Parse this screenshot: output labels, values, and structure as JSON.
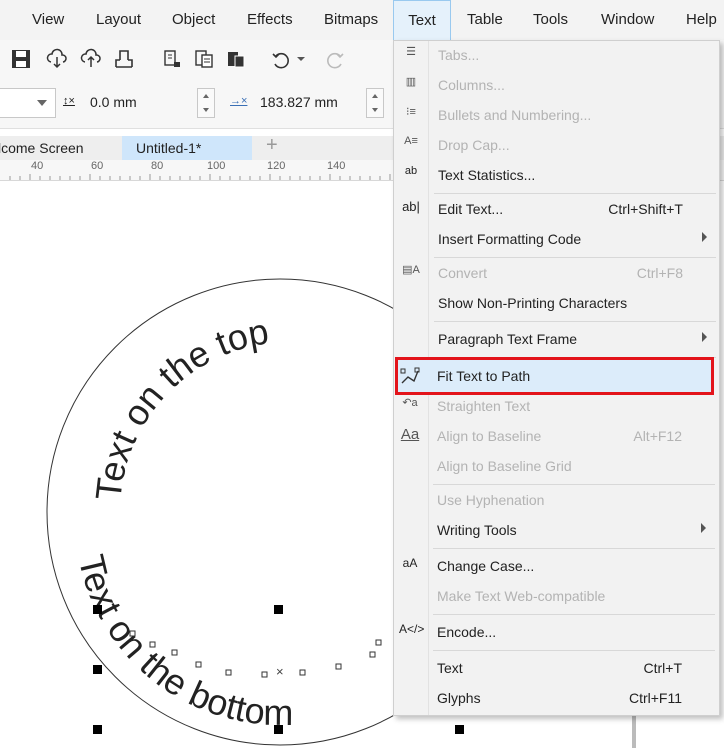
{
  "menubar": {
    "items": [
      "View",
      "Layout",
      "Object",
      "Effects",
      "Bitmaps",
      "Text",
      "Table",
      "Tools",
      "Window",
      "Help"
    ],
    "active": "Text"
  },
  "propbar": {
    "x_value": "0.0 mm",
    "width_value": "183.827 mm"
  },
  "tabs": {
    "welcome": "lcome Screen",
    "untitled": "Untitled-1*"
  },
  "ruler": {
    "labels": [
      "40",
      "60",
      "80",
      "100",
      "120",
      "140"
    ]
  },
  "canvas": {
    "top_text": "Text on the top",
    "bottom_text": "Text on the bottom"
  },
  "text_menu": {
    "items": [
      {
        "label": "Tabs...",
        "shortcut": "",
        "disabled": true,
        "submenu": false,
        "icon": "tabs-icon"
      },
      {
        "label": "Columns...",
        "shortcut": "",
        "disabled": true,
        "submenu": false,
        "icon": "columns-icon"
      },
      {
        "label": "Bullets and Numbering...",
        "shortcut": "",
        "disabled": true,
        "submenu": false,
        "icon": "bullets-icon"
      },
      {
        "label": "Drop Cap...",
        "shortcut": "",
        "disabled": true,
        "submenu": false,
        "icon": "drop-cap-icon"
      },
      {
        "label": "Text Statistics...",
        "shortcut": "",
        "disabled": false,
        "submenu": false,
        "icon": "text-statistics-icon"
      },
      {
        "label": "Edit Text...",
        "shortcut": "Ctrl+Shift+T",
        "disabled": false,
        "submenu": false,
        "icon": "edit-text-icon"
      },
      {
        "label": "Insert Formatting Code",
        "shortcut": "",
        "disabled": false,
        "submenu": true,
        "icon": ""
      },
      {
        "label": "Convert",
        "shortcut": "Ctrl+F8",
        "disabled": true,
        "submenu": false,
        "icon": "convert-icon"
      },
      {
        "label": "Show Non-Printing Characters",
        "shortcut": "",
        "disabled": false,
        "submenu": false,
        "icon": ""
      },
      {
        "label": "Paragraph Text Frame",
        "shortcut": "",
        "disabled": false,
        "submenu": true,
        "icon": ""
      },
      {
        "label": "Fit Text to Path",
        "shortcut": "",
        "disabled": false,
        "submenu": false,
        "icon": "fit-text-to-path-icon",
        "highlighted": true
      },
      {
        "label": "Straighten Text",
        "shortcut": "",
        "disabled": true,
        "submenu": false,
        "icon": "straighten-text-icon"
      },
      {
        "label": "Align to Baseline",
        "shortcut": "Alt+F12",
        "disabled": true,
        "submenu": false,
        "icon": "align-baseline-icon"
      },
      {
        "label": "Align to Baseline Grid",
        "shortcut": "",
        "disabled": true,
        "submenu": false,
        "icon": ""
      },
      {
        "label": "Use Hyphenation",
        "shortcut": "",
        "disabled": true,
        "submenu": false,
        "icon": ""
      },
      {
        "label": "Writing Tools",
        "shortcut": "",
        "disabled": false,
        "submenu": true,
        "icon": ""
      },
      {
        "label": "Change Case...",
        "shortcut": "",
        "disabled": false,
        "submenu": false,
        "icon": "change-case-icon"
      },
      {
        "label": "Make Text Web-compatible",
        "shortcut": "",
        "disabled": true,
        "submenu": false,
        "icon": ""
      },
      {
        "label": "Encode...",
        "shortcut": "",
        "disabled": false,
        "submenu": false,
        "icon": "encode-icon"
      },
      {
        "label": "Text",
        "shortcut": "Ctrl+T",
        "disabled": false,
        "submenu": false,
        "icon": ""
      },
      {
        "label": "Glyphs",
        "shortcut": "Ctrl+F11",
        "disabled": false,
        "submenu": false,
        "icon": ""
      }
    ]
  },
  "colors": {
    "highlight_border": "#e3141b",
    "highlight_fill": "#dcecfa",
    "tab_active": "#cfe6fb"
  }
}
